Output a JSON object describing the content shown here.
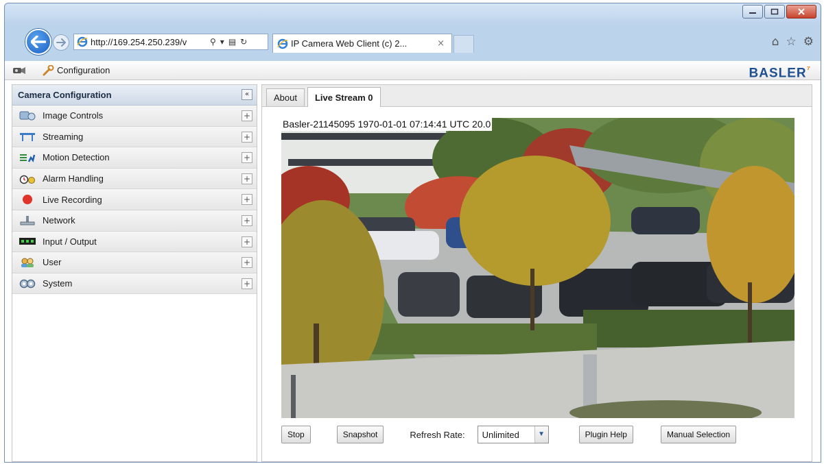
{
  "browser": {
    "url": "http://169.254.250.239/v",
    "tab_title": "IP Camera Web Client (c) 2...",
    "tab_close": "×"
  },
  "toolbar": {
    "config_label": "Configuration",
    "brand": "BASLER"
  },
  "sidebar": {
    "title": "Camera Configuration",
    "collapse_symbol": "«",
    "items": [
      {
        "label": "Image Controls",
        "icon": "image-controls-icon"
      },
      {
        "label": "Streaming",
        "icon": "streaming-icon"
      },
      {
        "label": "Motion Detection",
        "icon": "motion-detection-icon"
      },
      {
        "label": "Alarm Handling",
        "icon": "alarm-icon"
      },
      {
        "label": "Live Recording",
        "icon": "record-icon"
      },
      {
        "label": "Network",
        "icon": "network-icon"
      },
      {
        "label": "Input / Output",
        "icon": "io-icon"
      },
      {
        "label": "User",
        "icon": "user-icon"
      },
      {
        "label": "System",
        "icon": "system-icon"
      }
    ],
    "expand_symbol": "+"
  },
  "content_tabs": [
    {
      "label": "About",
      "active": false
    },
    {
      "label": "Live Stream 0",
      "active": true
    }
  ],
  "video": {
    "overlay": "Basler-21145095 1970-01-01 07:14:41 UTC  20.0"
  },
  "controls": {
    "stop": "Stop",
    "snapshot": "Snapshot",
    "refresh_label": "Refresh Rate:",
    "refresh_value": "Unlimited",
    "plugin_help": "Plugin Help",
    "manual_selection": "Manual Selection"
  },
  "colors": {
    "accent": "#1d4f91",
    "brand_mark": "#e57c1f",
    "record_red": "#e0342b"
  }
}
